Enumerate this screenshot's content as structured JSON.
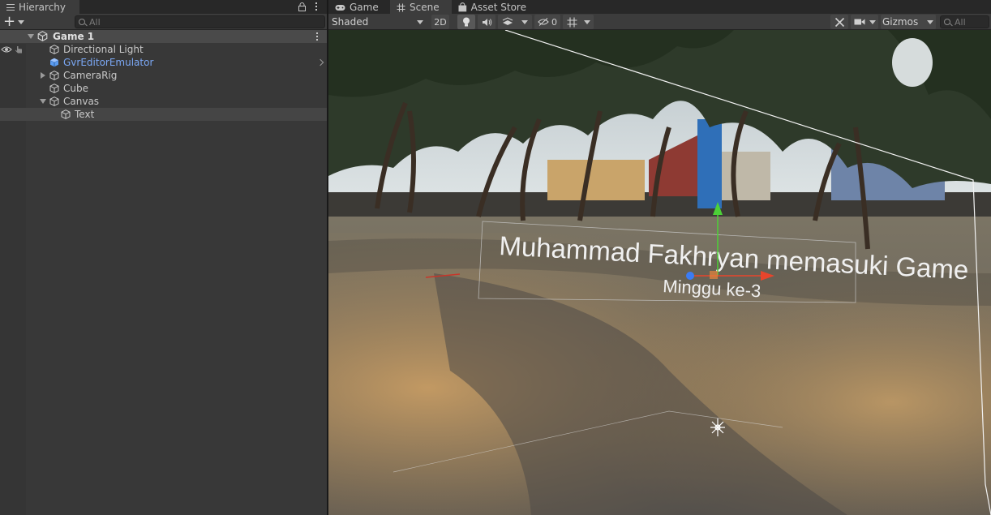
{
  "hierarchy": {
    "tab_label": "Hierarchy",
    "search_placeholder": "All",
    "scene_name": "Game 1",
    "items": [
      {
        "label": "Directional Light"
      },
      {
        "label": "GvrEditorEmulator"
      },
      {
        "label": "CameraRig"
      },
      {
        "label": "Cube"
      },
      {
        "label": "Canvas"
      },
      {
        "label": "Text"
      }
    ]
  },
  "scene_tabs": [
    {
      "label": "Game",
      "icon": "gamepad-icon"
    },
    {
      "label": "Scene",
      "icon": "grid-hash-icon"
    },
    {
      "label": "Asset Store",
      "icon": "shopping-bag-icon"
    }
  ],
  "scene_toolbar": {
    "draw_mode": "Shaded",
    "mode_2d": "2D",
    "hidden_count": "0",
    "gizmos": "Gizmos",
    "search_placeholder": "All"
  },
  "viewport": {
    "text_line1": "Muhammad Fakhryan memasuki Game",
    "text_line2": "Minggu ke-3"
  },
  "colors": {
    "panel_bg": "#383838",
    "tab_bg": "#282828",
    "prefab_text": "#7ba8f5",
    "gizmo_x": "#e8452c",
    "gizmo_y": "#4cd137",
    "gizmo_z": "#3b7cf5"
  }
}
